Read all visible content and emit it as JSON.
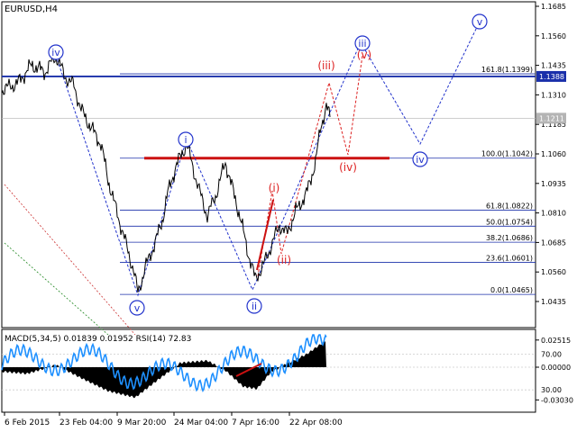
{
  "window": {
    "symbol_title": "EURUSD,H4"
  },
  "price_axis": {
    "ticks": [
      {
        "v": 1.1685,
        "label": "1.1685"
      },
      {
        "v": 1.156,
        "label": "1.1560"
      },
      {
        "v": 1.1435,
        "label": "1.1435"
      },
      {
        "v": 1.131,
        "label": "1.1310"
      },
      {
        "v": 1.1185,
        "label": "1.1185"
      },
      {
        "v": 1.106,
        "label": "1.1060"
      },
      {
        "v": 1.0935,
        "label": "1.0935"
      },
      {
        "v": 1.081,
        "label": "1.0810"
      },
      {
        "v": 1.0685,
        "label": "1.0685"
      },
      {
        "v": 1.056,
        "label": "1.0560"
      },
      {
        "v": 1.0435,
        "label": "1.0435"
      }
    ],
    "flags": [
      {
        "v": 1.1388,
        "label": "1.1388",
        "bg": "#1a2faa",
        "fg": "#ffffff"
      },
      {
        "v": 1.1211,
        "label": "1.1211",
        "bg": "#b4b4b4",
        "fg": "#ffffff"
      }
    ]
  },
  "fibonacci": {
    "levels": [
      {
        "ratio": "161.8",
        "price": 1.1399,
        "label": "161.8(1.1399)"
      },
      {
        "ratio": "100.0",
        "price": 1.1042,
        "label": "100.0(1.1042)"
      },
      {
        "ratio": "61.8",
        "price": 1.0822,
        "label": "61.8(1.0822)"
      },
      {
        "ratio": "50.0",
        "price": 1.0754,
        "label": "50.0(1.0754)"
      },
      {
        "ratio": "38.2",
        "price": 1.0686,
        "label": "38.2(1.0686)"
      },
      {
        "ratio": "23.6",
        "price": 1.0601,
        "label": "23.6(1.0601)"
      },
      {
        "ratio": "0.0",
        "price": 1.0465,
        "label": "0.0(1.0465)"
      }
    ]
  },
  "wave_labels": {
    "blue": [
      "iv",
      "i",
      "v",
      "ii",
      "iii",
      "iv",
      "v"
    ],
    "red": [
      "i",
      "ii",
      "iii",
      "iv",
      "v"
    ]
  },
  "indicator": {
    "title": "MACD(5,34,5) 0.01839 0.01952 RSI(14) 72.83",
    "ticks": [
      {
        "v": 0.02515,
        "label": "0.02515"
      },
      {
        "v": 0.0,
        "label": "0.00000"
      },
      {
        "v": -0.0303,
        "label": "-0.03030"
      }
    ],
    "rsi_levels": [
      {
        "label": "70.00"
      },
      {
        "label": "30.00"
      }
    ]
  },
  "time_axis": {
    "labels": [
      "6 Feb 2015",
      "23 Feb 04:00",
      "9 Mar 20:00",
      "24 Mar 04:00",
      "7 Apr 16:00",
      "22 Apr 08:00"
    ]
  },
  "colors": {
    "price_line": "#000000",
    "fib_line": "#1a2faa",
    "resistance_line": "#cc1111",
    "blue_wave": "#2233cc",
    "red_wave": "#dd2222",
    "rsi_line": "#1e90ff",
    "macd_hist": "#000000"
  }
}
